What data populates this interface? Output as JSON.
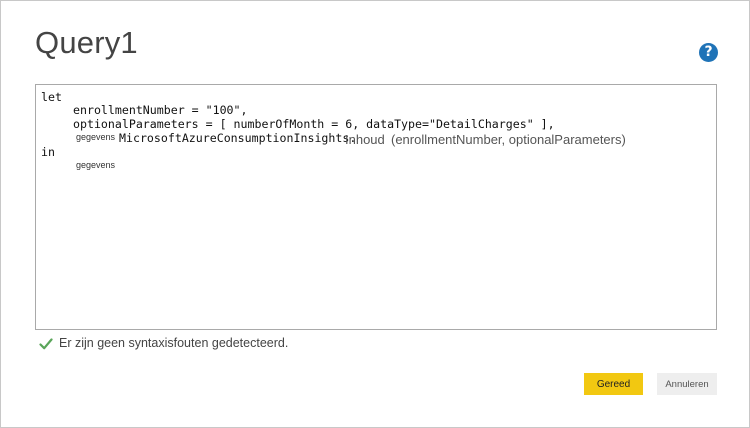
{
  "dialog": {
    "title": "Query1",
    "help_icon": "question-circle-icon",
    "help_glyph": "?"
  },
  "editor": {
    "line1": "let",
    "line2": "enrollmentNumber = \"100\",",
    "line3": "optionalParameters = [ numberOfMonth = 6, dataType=\"DetailCharges\" ],",
    "line4_label": "gegevens",
    "line4_code": "MicrosoftAzureConsumptionInsights.",
    "line4_func": "Inhoud",
    "line4_args": "(enrollmentNumber, optionalParameters)",
    "line5": "in",
    "line6_label": "gegevens"
  },
  "status": {
    "icon": "checkmark-icon",
    "text": "Er zijn geen syntaxisfouten gedetecteerd.",
    "color": "#5aa55a"
  },
  "buttons": {
    "ok_label": "Gereed",
    "cancel_label": "Annuleren",
    "ok_color": "#f2c811"
  }
}
